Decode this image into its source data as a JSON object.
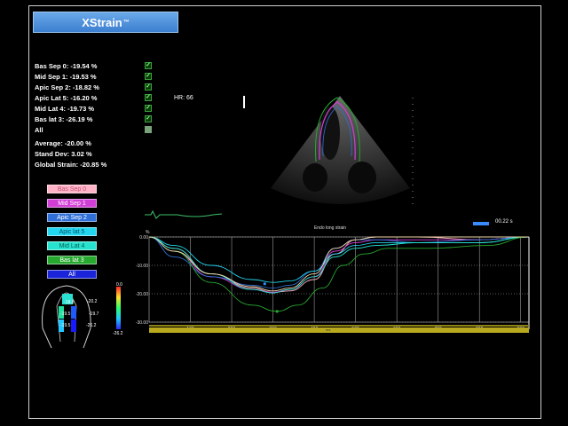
{
  "app": {
    "brand": "XStrain",
    "trademark": "™"
  },
  "segments": [
    {
      "label": "Bas Sep 0: -19.54 %",
      "checked": true
    },
    {
      "label": "Mid Sep 1: -19.53 %",
      "checked": true
    },
    {
      "label": "Apic Sep 2: -18.82 %",
      "checked": true
    },
    {
      "label": "Apic Lat 5: -16.20 %",
      "checked": true
    },
    {
      "label": "Mid Lat 4: -19.73 %",
      "checked": true
    },
    {
      "label": "Bas lat 3: -26.19 %",
      "checked": true
    },
    {
      "label": "All",
      "checked": true
    }
  ],
  "stats": {
    "average": "Average: -20.00 %",
    "stdev": "Stand Dev: 3.02 %",
    "global": "Global Strain: -20.85 %"
  },
  "segment_buttons": [
    {
      "label": "Bas Sep 0",
      "color": "#ffb3c6",
      "text": "#c0567a"
    },
    {
      "label": "Mid Sep 1",
      "color": "#d23fd6",
      "text": "#ffffff"
    },
    {
      "label": "Apic Sep 2",
      "color": "#2f6fd8",
      "text": "#ffffff"
    },
    {
      "label": "Apic lat 5",
      "color": "#22d6f0",
      "text": "#0b4f5e"
    },
    {
      "label": "Mid Lat 4",
      "color": "#26e3cf",
      "text": "#0b5e54"
    },
    {
      "label": "Bas lat 3",
      "color": "#27a82f",
      "text": "#ffffff"
    },
    {
      "label": "All",
      "color": "#1a24d8",
      "text": "#ffffff"
    }
  ],
  "bullseye": {
    "values": [
      "-20.2",
      "-19.7",
      "-16.2",
      "-18.8",
      "-19.5",
      "-19.5",
      "-26.2"
    ],
    "scale_max": "0.0",
    "scale_min": "-26.2"
  },
  "echo": {
    "hr": "HR: 66"
  },
  "playback": {
    "time": "00.22 s"
  },
  "chart_data": {
    "type": "line",
    "title": "Endo long strain",
    "ylabel": "%",
    "xlim": [
      0,
      920
    ],
    "ylim": [
      -30,
      0
    ],
    "x_ticks": [
      "100",
      "200",
      "300",
      "400",
      "500",
      "600",
      "700",
      "800",
      "900"
    ],
    "y_ticks": [
      "0.00",
      "-10.00",
      "-20.00",
      "-30.00"
    ],
    "x_unit_label": "ms",
    "series": [
      {
        "color": "#ffb3c6",
        "x": [
          0,
          60,
          150,
          250,
          300,
          340,
          400,
          450,
          500,
          550,
          650,
          800,
          920
        ],
        "y": [
          0,
          -4,
          -13,
          -18,
          -19.5,
          -19,
          -15,
          -6,
          -1,
          0,
          0,
          -1,
          0
        ]
      },
      {
        "color": "#d23fd6",
        "x": [
          0,
          60,
          150,
          250,
          300,
          340,
          400,
          450,
          500,
          550,
          650,
          800,
          920
        ],
        "y": [
          0,
          -5,
          -14,
          -18.5,
          -19.5,
          -18.5,
          -14,
          -5,
          -2,
          -1,
          -1,
          -1,
          0
        ]
      },
      {
        "color": "#2f6fd8",
        "x": [
          0,
          60,
          150,
          250,
          300,
          340,
          400,
          450,
          500,
          550,
          650,
          800,
          920
        ],
        "y": [
          0,
          -7,
          -14,
          -17,
          -18,
          -17,
          -12,
          -4,
          -1,
          -1,
          -2,
          -1,
          0
        ]
      },
      {
        "color": "#22d6f0",
        "x": [
          0,
          60,
          150,
          250,
          300,
          340,
          400,
          450,
          500,
          550,
          650,
          800,
          920
        ],
        "y": [
          0,
          -3,
          -10,
          -15,
          -16,
          -15.5,
          -12,
          -6,
          -3,
          -2,
          -2,
          -2,
          0
        ]
      },
      {
        "color": "#26e3cf",
        "x": [
          0,
          60,
          150,
          250,
          300,
          340,
          400,
          450,
          500,
          550,
          650,
          800,
          920
        ],
        "y": [
          0,
          -4,
          -13,
          -18.5,
          -19.7,
          -18.5,
          -14,
          -7,
          -4,
          -3,
          -2,
          -2,
          0
        ]
      },
      {
        "color": "#27a82f",
        "x": [
          0,
          60,
          150,
          250,
          310,
          360,
          420,
          470,
          520,
          580,
          680,
          820,
          920
        ],
        "y": [
          0,
          -5,
          -16,
          -24,
          -26.2,
          -24,
          -18,
          -10,
          -6,
          -4,
          -4,
          -3,
          0
        ]
      },
      {
        "color": "#f0d6a8",
        "x": [
          0,
          60,
          150,
          250,
          300,
          340,
          400,
          450,
          500,
          550,
          650,
          800,
          920
        ],
        "y": [
          0,
          -5,
          -13,
          -17.5,
          -19,
          -18,
          -13,
          -4,
          -1,
          0,
          0,
          0,
          0
        ]
      }
    ],
    "markers": [
      {
        "x": 280,
        "y": -16.5,
        "color": "#3a8bff"
      },
      {
        "x": 310,
        "y": -26.2,
        "color": "#27a82f"
      }
    ],
    "cursor_x": 920
  }
}
